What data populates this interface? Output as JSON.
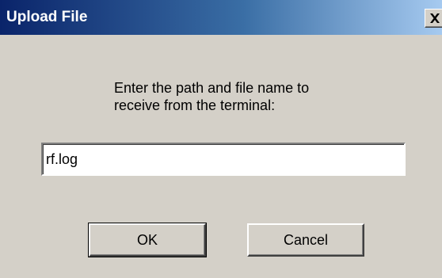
{
  "window": {
    "title": "Upload File",
    "close_icon": "close-icon",
    "close_glyph": "×"
  },
  "prompt": {
    "line1": "Enter the path and file name to",
    "line2": "receive from the terminal:"
  },
  "path_input": {
    "value": "rf.log"
  },
  "buttons": {
    "ok_label": "OK",
    "cancel_label": "Cancel"
  },
  "colors": {
    "title_bar_start": "#0a246a",
    "title_bar_end": "#a6caf0",
    "dialog_face": "#d4d0c8"
  }
}
